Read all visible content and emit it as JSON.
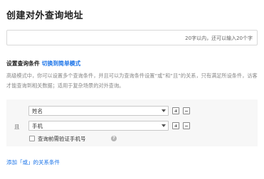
{
  "page": {
    "title": "创建对外查询地址"
  },
  "address_input": {
    "value": "",
    "placeholder": "",
    "hint": "20字以内，还可以输入20个字"
  },
  "conditions": {
    "section_label": "设置查询条件",
    "switch_link": "切换到简单模式",
    "description": "高级模式中，你可以设置多个查询条件，并且可以为查询条件设置“或”和“且”的关系，只有满足所设条件，访客才能查询到相关数据；适用于复杂场景的对外查询。",
    "group": {
      "relation_label": "且",
      "fields": [
        {
          "selected": "姓名"
        },
        {
          "selected": "手机"
        }
      ],
      "verify_checkbox_label": "查询前需验证手机号",
      "verify_checked": false
    },
    "add_or_link": "添加「或」的关系条件"
  },
  "icons": {
    "add": "plus-square-icon",
    "remove": "minus-square-icon",
    "help": "question-circle-icon",
    "dropdown": "caret-down-icon"
  }
}
